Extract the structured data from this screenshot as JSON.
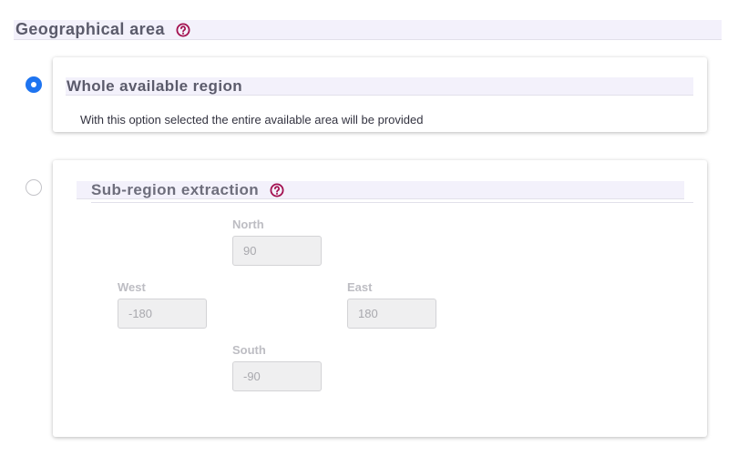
{
  "geographical_area": {
    "title": "Geographical area",
    "help_icon": "question-circle-icon"
  },
  "options": [
    {
      "title": "Whole available region",
      "description": "With this option selected the entire available area will be provided",
      "selected": true
    },
    {
      "title": "Sub-region extraction",
      "help_icon": "question-circle-icon",
      "selected": false
    }
  ],
  "subregion": {
    "north": {
      "label": "North",
      "value": "90"
    },
    "west": {
      "label": "West",
      "value": "-180"
    },
    "east": {
      "label": "East",
      "value": "180"
    },
    "south": {
      "label": "South",
      "value": "-90"
    }
  },
  "colors": {
    "accent": "#1e74f0",
    "help_icon": "#a3104f",
    "header_bg": "#f3f1fb"
  }
}
